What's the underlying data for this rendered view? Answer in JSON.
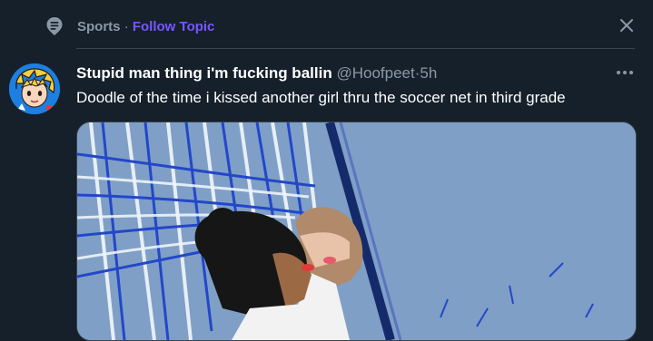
{
  "topic": {
    "name": "Sports",
    "separator": "·",
    "follow_label": "Follow Topic",
    "icon": "topic-icon",
    "close_icon": "close-icon"
  },
  "tweet": {
    "author_name": "Stupid man thing i'm fucking ballin",
    "handle": "@Hoofpeet",
    "dot": "·",
    "time": "5h",
    "text": "Doodle of the time i kissed another girl thru the soccer net in third grade",
    "more_icon": "more-icon",
    "media_description": "drawing-soccer-net-kiss"
  },
  "colors": {
    "background": "#15202b",
    "accent": "#7856ff",
    "secondary_text": "#8b98a5",
    "divider": "#38444d"
  }
}
